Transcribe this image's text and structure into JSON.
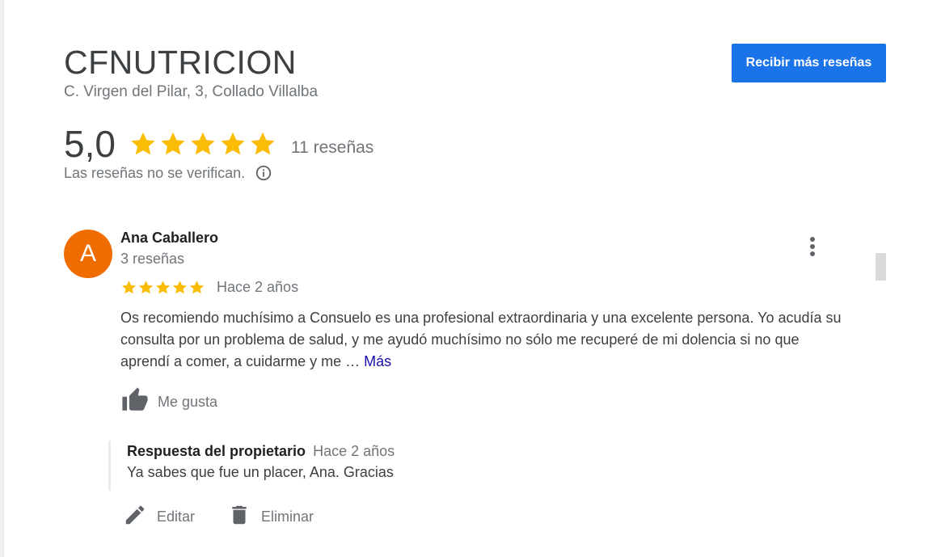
{
  "business": {
    "name": "CFNUTRICION",
    "address": "C. Virgen del Pilar, 3, Collado Villalba"
  },
  "header": {
    "cta_label": "Recibir más reseñas"
  },
  "summary": {
    "rating": "5,0",
    "stars": 5,
    "review_count_label": "11 reseñas",
    "disclaimer": "Las reseñas no se verifican."
  },
  "review": {
    "avatar_letter": "A",
    "reviewer_name": "Ana Caballero",
    "reviewer_reviews": "3 reseñas",
    "stars": 5,
    "time": "Hace 2 años",
    "text": "Os recomiendo muchísimo a Consuelo es una profesional extraordinaria y una excelente persona. Yo acudía su consulta por un problema de salud, y me ayudó muchísimo no sólo me recuperé de mi dolencia si no que aprendí a comer, a cuidarme y me … ",
    "more_label": "Más",
    "like_label": "Me gusta"
  },
  "owner_reply": {
    "title": "Respuesta del propietario",
    "time": "Hace 2 años",
    "text": "Ya sabes que fue un placer, Ana. Gracias"
  },
  "actions": {
    "edit_label": "Editar",
    "delete_label": "Eliminar"
  },
  "colors": {
    "accent": "#1a73e8",
    "star": "#fbbc04",
    "avatar": "#ef6c00",
    "link": "#1a0dab"
  },
  "icons": {
    "star": "star-icon",
    "info": "info-icon",
    "more": "more-vert-icon",
    "like": "thumb-up-icon",
    "edit": "pencil-icon",
    "delete": "trash-icon"
  }
}
